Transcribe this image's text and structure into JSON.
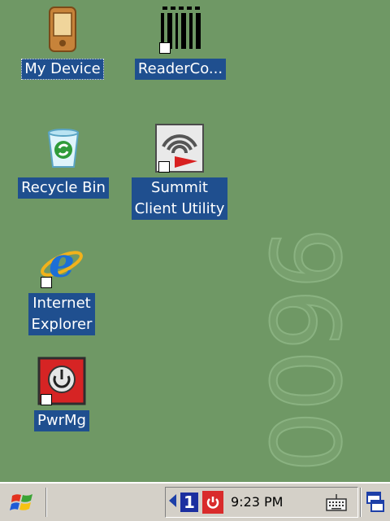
{
  "desktop": {
    "watermark_text": "9600",
    "icons": [
      {
        "name": "my-device",
        "label": "My Device",
        "icon": "pda-device-icon"
      },
      {
        "name": "reader-config",
        "label": "ReaderCo...",
        "icon": "barcode-icon"
      },
      {
        "name": "recycle-bin",
        "label": "Recycle Bin",
        "icon": "recycle-bin-icon"
      },
      {
        "name": "summit-client-utility",
        "label": "Summit\nClient Utility",
        "icon": "wireless-signal-icon"
      },
      {
        "name": "internet-explorer",
        "label": "Internet\nExplorer",
        "icon": "internet-explorer-icon"
      },
      {
        "name": "pwrmg",
        "label": "PwrMg",
        "icon": "power-button-icon"
      }
    ]
  },
  "taskbar": {
    "start_icon": "windows-flag-icon",
    "tray": {
      "arrow_icon": "left-arrow-icon",
      "input_mode": "1",
      "power_icon": "power-icon",
      "time": "9:23 PM",
      "keyboard_icon": "keyboard-icon"
    },
    "switch_icon": "window-switch-icon"
  }
}
